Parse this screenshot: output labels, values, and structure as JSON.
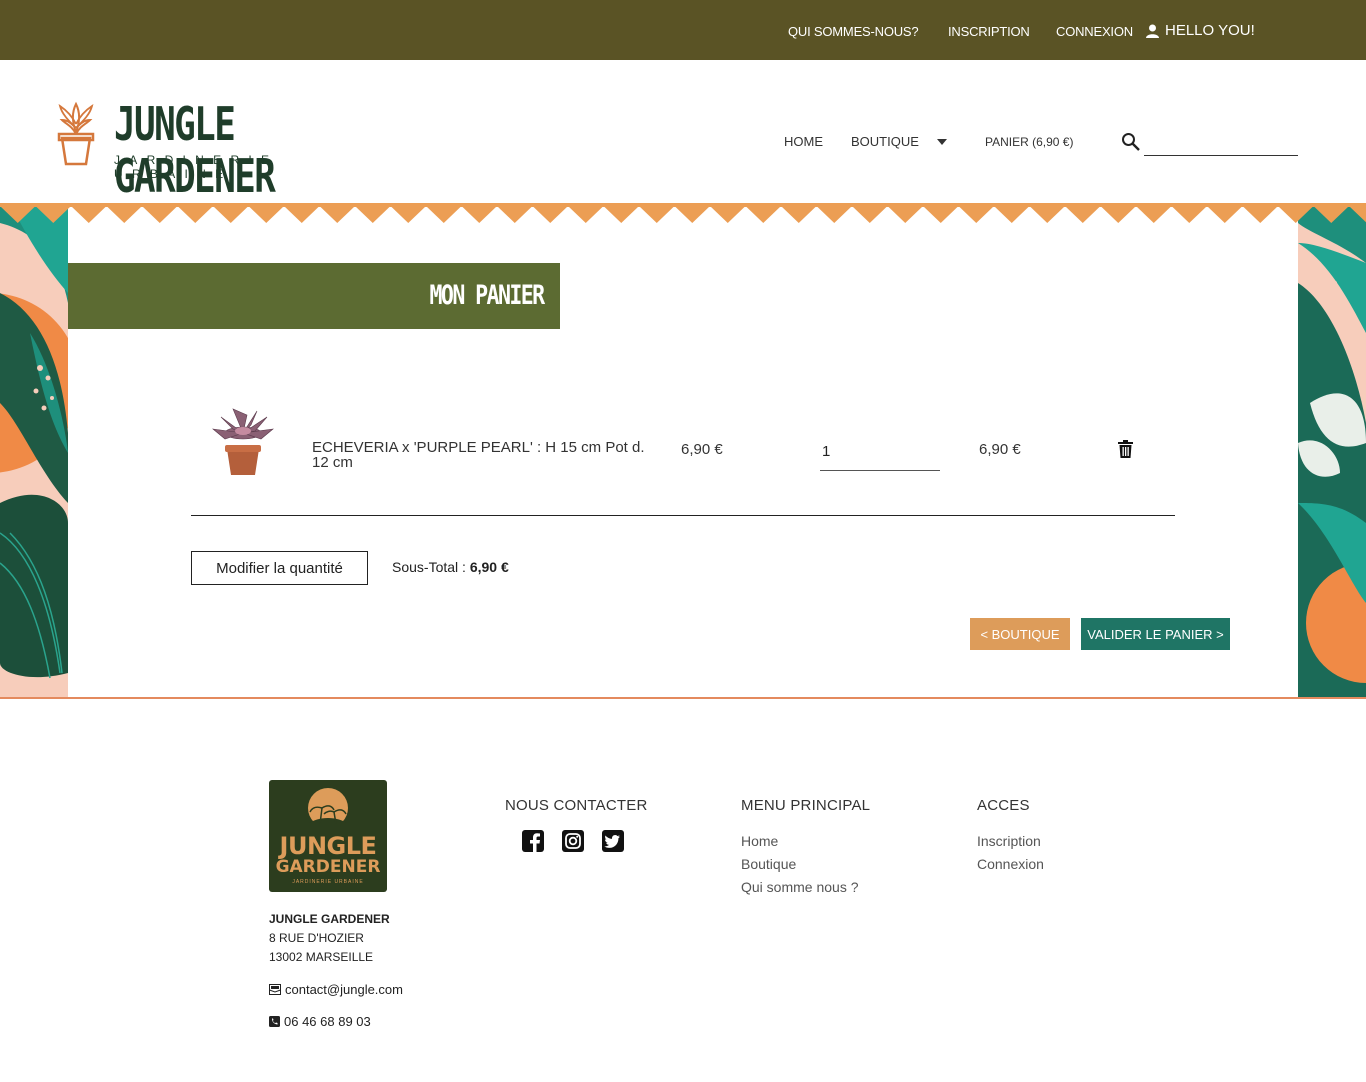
{
  "topbar": {
    "about": "QUI SOMMES-NOUS?",
    "signup": "INSCRIPTION",
    "login": "CONNEXION",
    "hello": "HELLO YOU!"
  },
  "header": {
    "logo_title": "JUNGLE GARDENER",
    "logo_subtitle": "JARDINERIE URBAINE",
    "nav": {
      "home": "HOME",
      "shop": "BOUTIQUE",
      "cart": "PANIER (6,90 €)"
    },
    "search_placeholder": ""
  },
  "page": {
    "title": "MON PANIER"
  },
  "cart": {
    "items": [
      {
        "name": "ECHEVERIA x 'PURPLE PEARL' : H 15 cm Pot d. 12 cm",
        "price": "6,90 €",
        "quantity": "1",
        "total": "6,90 €"
      }
    ],
    "modify_label": "Modifier la quantité",
    "subtotal_label": "Sous-Total :",
    "subtotal_value": "6,90 €",
    "back_label": "< BOUTIQUE",
    "validate_label": "VALIDER LE PANIER >"
  },
  "footer": {
    "logo_line1": "JUNGLE",
    "logo_line2": "GARDENER",
    "logo_line3": "JARDINERIE URBAINE",
    "company": "JUNGLE GARDENER",
    "address1": "8 RUE D'HOZIER",
    "address2": "13002 MARSEILLE",
    "email": "contact@jungle.com",
    "phone": "06 46 68 89 03",
    "contact_heading": "NOUS CONTACTER",
    "menu_heading": "MENU PRINCIPAL",
    "menu_links": [
      "Home",
      "Boutique",
      "Qui somme nous ?"
    ],
    "access_heading": "ACCES",
    "access_links": [
      "Inscription",
      "Connexion"
    ]
  },
  "colors": {
    "topbar": "#5a5325",
    "title_band": "#5c6b32",
    "accent_orange": "#dd9c5a",
    "accent_teal": "#1f7565",
    "logo_green": "#1f3d2a"
  }
}
